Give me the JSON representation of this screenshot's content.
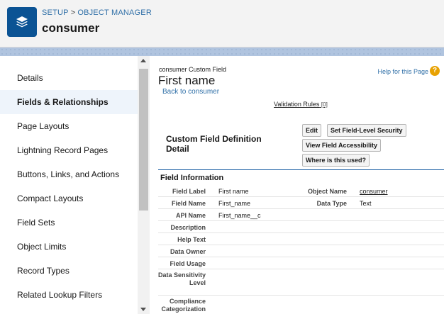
{
  "header": {
    "breadcrumb_setup": "SETUP",
    "breadcrumb_sep": ">",
    "breadcrumb_object_manager": "OBJECT MANAGER",
    "object_title": "consumer"
  },
  "sidebar": {
    "items": [
      {
        "label": "Details"
      },
      {
        "label": "Fields & Relationships"
      },
      {
        "label": "Page Layouts"
      },
      {
        "label": "Lightning Record Pages"
      },
      {
        "label": "Buttons, Links, and Actions"
      },
      {
        "label": "Compact Layouts"
      },
      {
        "label": "Field Sets"
      },
      {
        "label": "Object Limits"
      },
      {
        "label": "Record Types"
      },
      {
        "label": "Related Lookup Filters"
      }
    ],
    "active_index": 1
  },
  "main": {
    "pre_title": "consumer Custom Field",
    "title": "First name",
    "back_link": "Back to consumer",
    "help_link": "Help for this Page",
    "help_icon": "?",
    "validation_rules": "Validation Rules",
    "validation_count": "[0]",
    "section_header": "Custom Field Definition Detail",
    "buttons": {
      "edit": "Edit",
      "set_fls": "Set Field-Level Security",
      "view_access": "View Field Accessibility",
      "where_used": "Where is this used?"
    },
    "field_info_title": "Field Information",
    "rows": [
      {
        "label": "Field Label",
        "value": "First name",
        "label2": "Object Name",
        "value2": "consumer"
      },
      {
        "label": "Field Name",
        "value": "First_name",
        "label2": "Data Type",
        "value2": "Text"
      },
      {
        "label": "API Name",
        "value": "First_name__c"
      },
      {
        "label": "Description",
        "value": ""
      },
      {
        "label": "Help Text",
        "value": ""
      },
      {
        "label": "Data Owner",
        "value": ""
      },
      {
        "label": "Field Usage",
        "value": ""
      },
      {
        "label": "Data Sensitivity Level",
        "value": ""
      },
      {
        "label": "Compliance Categorization",
        "value": ""
      }
    ]
  },
  "colors": {
    "brand": "#0b5394",
    "link": "#2f6fa7",
    "active_bg": "#eef4fb",
    "help_icon": "#e8a202"
  }
}
